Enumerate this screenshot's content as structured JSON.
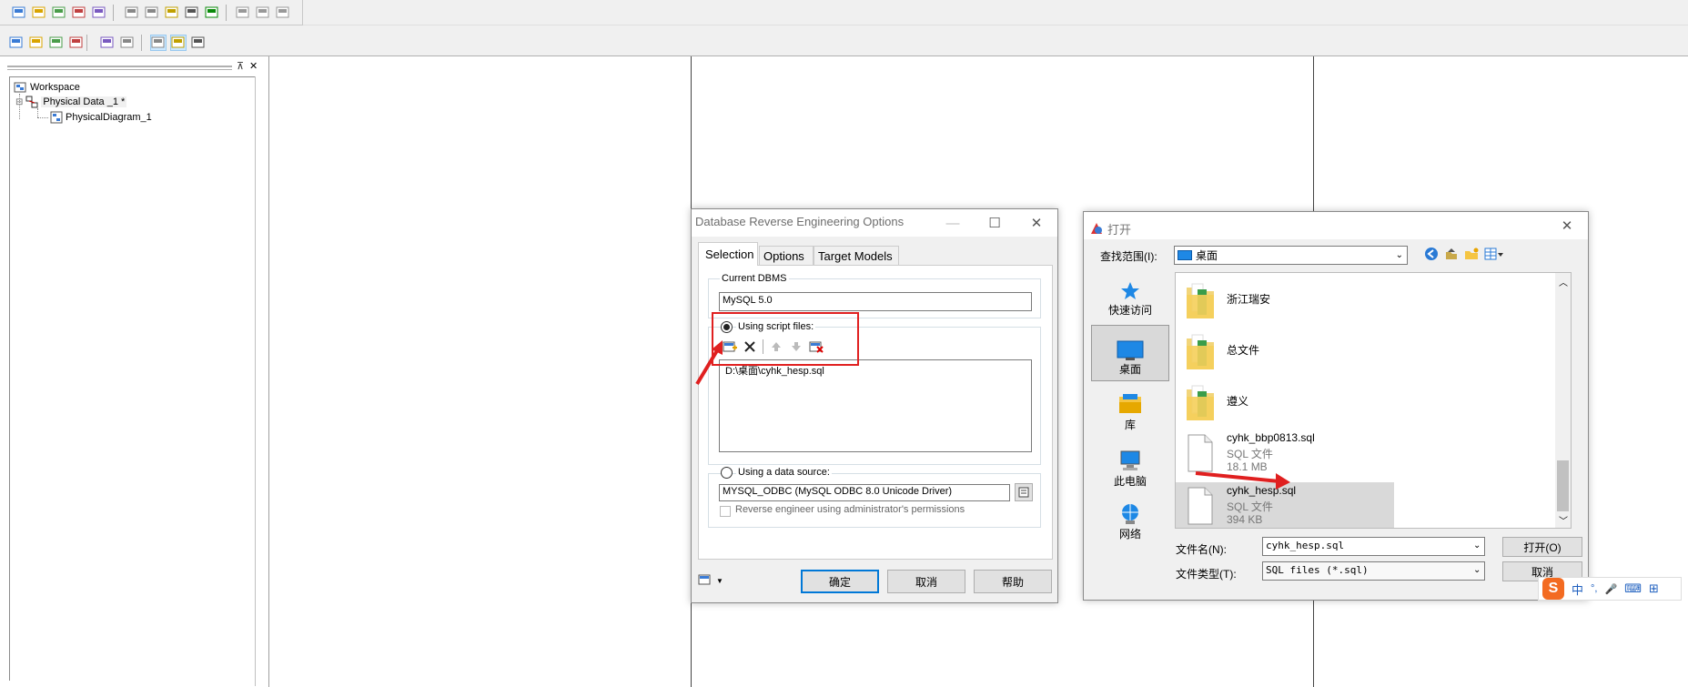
{
  "toolbar": {
    "icons_row1": [
      "new-model-icon",
      "open-icon",
      "workspace-icon",
      "refresh-icon",
      "check-model-icon",
      "copy-icon",
      "properties-icon",
      "edit-icon",
      "format-icon",
      "text-icon",
      "fold-icon",
      "back-icon",
      "forward-icon"
    ],
    "icons_row2": [
      "table-icon",
      "view-icon",
      "procedure-icon",
      "reference-icon",
      "generate-icon",
      "reverse-icon",
      "select-icon",
      "grid-icon",
      "list-icon"
    ]
  },
  "browser": {
    "pin": "⊼",
    "close": "✕",
    "tree": [
      {
        "label": "Workspace",
        "icon": "workspace-icon"
      },
      {
        "label": "Physical Data _1 *",
        "icon": "model-icon",
        "expander": "⊟"
      },
      {
        "label": "PhysicalDiagram_1",
        "icon": "diagram-icon"
      }
    ]
  },
  "reverse_dialog": {
    "title": "Database Reverse Engineering Options",
    "window_buttons": {
      "minimize": "—",
      "maximize": "☐",
      "close": "✕"
    },
    "tabs": [
      "Selection",
      "Options",
      "Target Models"
    ],
    "current_dbms_label": "Current DBMS",
    "current_dbms_value": "MySQL 5.0",
    "script_radio_label": "Using script files:",
    "script_files": [
      "D:\\桌面\\cyhk_hesp.sql"
    ],
    "datasource_radio_label": "Using a data source:",
    "datasource_value": "MYSQL_ODBC (MySQL ODBC 8.0 Unicode Driver)",
    "admin_checkbox_label": "Reverse engineer using administrator's permissions",
    "ok": "确定",
    "cancel": "取消",
    "help": "帮助"
  },
  "open_dialog": {
    "title": "打开",
    "close": "✕",
    "lookin_label": "查找范围(I):",
    "lookin_value": "桌面",
    "nav": [
      {
        "label": "快速访问",
        "icon": "star-icon"
      },
      {
        "label": "桌面",
        "icon": "desktop-icon"
      },
      {
        "label": "库",
        "icon": "library-icon"
      },
      {
        "label": "此电脑",
        "icon": "computer-icon"
      },
      {
        "label": "网络",
        "icon": "network-icon"
      }
    ],
    "files": [
      {
        "name": "浙江瑞安",
        "type": "",
        "size": "",
        "kind": "folder"
      },
      {
        "name": "总文件",
        "type": "",
        "size": "",
        "kind": "folder"
      },
      {
        "name": "遵义",
        "type": "",
        "size": "",
        "kind": "folder"
      },
      {
        "name": "cyhk_bbp0813.sql",
        "type": "SQL 文件",
        "size": "18.1 MB",
        "kind": "file"
      },
      {
        "name": "cyhk_hesp.sql",
        "type": "SQL 文件",
        "size": "394 KB",
        "kind": "file"
      }
    ],
    "filename_label": "文件名(N):",
    "filename_value": "cyhk_hesp.sql",
    "filetype_label": "文件类型(T):",
    "filetype_value": "SQL files (*.sql)",
    "open_button": "打开(O)",
    "cancel_button": "取消"
  },
  "ime": {
    "items": [
      "中",
      "°,",
      "🎤",
      "⌨",
      "⊞"
    ]
  },
  "colors": {
    "accent": "#0078d7",
    "annotation": "#e02020",
    "selection": "#cce8ff"
  }
}
